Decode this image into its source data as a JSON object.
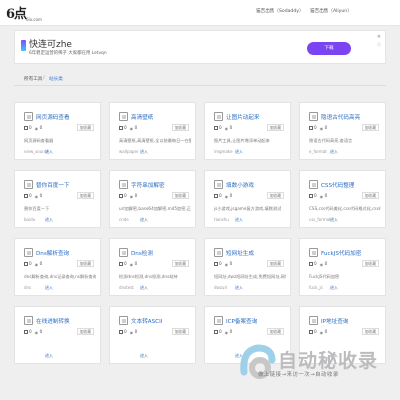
{
  "header": {
    "logo_text": "6点",
    "logo_sub": "6lo.com",
    "links": [
      "猫吉出售（Sodaddy）",
      "猫吉出售（Aliyun）"
    ]
  },
  "ad": {
    "title": "快连可zhe",
    "desc": "6年稳定运营的稀子 大家都在用 Letvqn",
    "button": "下载",
    "close": "✕",
    "info": "ⓘ"
  },
  "breadcrumb": {
    "items": [
      "所有工具",
      "站长类"
    ],
    "separator": "/"
  },
  "fav_label": "加收藏",
  "enter_label": "进入",
  "cards": [
    {
      "title": "网页源码查看",
      "likes": "0",
      "views": "0",
      "desc": "网页源码查看器",
      "slug": "view_source"
    },
    {
      "title": "高清壁纸",
      "likes": "0",
      "views": "0",
      "desc": "高清壁纸,高清壁纸,全以前最每日一在壁纸",
      "slug": "wallpaper"
    },
    {
      "title": "让图片动起来",
      "likes": "0",
      "views": "0",
      "desc": "图片工具,让图片增添单动起来",
      "slug": "imgmake"
    },
    {
      "title": "隐语古代码高亮",
      "likes": "0",
      "views": "0",
      "desc": "隐语古代码高亮,查语言",
      "slug": "e_format"
    },
    {
      "title": "替你百度一下",
      "likes": "0",
      "views": "0",
      "desc": "替你百度一下",
      "slug": "baidu"
    },
    {
      "title": "字符串加解密",
      "likes": "0",
      "views": "0",
      "desc": "url加解密,base64加解密,md5加密,正则...",
      "slug": "cnde"
    },
    {
      "title": "填数小游戏",
      "likes": "0",
      "views": "0",
      "desc": "js小游戏,jsgame复方游戏,填数测试",
      "slug": "tianshu"
    },
    {
      "title": "CSS代码整理",
      "likes": "0",
      "views": "0",
      "desc": "CSS,css代码美化,css代码格式化,css代码...",
      "slug": "css_format"
    },
    {
      "title": "Dns解析查询",
      "likes": "0",
      "views": "0",
      "desc": "dns解析查询,dns记录查询,ns解析查询",
      "slug": "dns"
    },
    {
      "title": "Dns检测",
      "likes": "0",
      "views": "0",
      "desc": "检测dns检测,dns检测,dns劫持",
      "slug": "dnstest"
    },
    {
      "title": "短网址生成",
      "likes": "0",
      "views": "0",
      "desc": "短网址,dwz短网址生成,免费短网址,网址...",
      "slug": "dwzurl"
    },
    {
      "title": "FuckJS代码加密",
      "likes": "0",
      "views": "0",
      "desc": "FuckJS代码加密",
      "slug": "fuck_js"
    },
    {
      "title": "在线进制转换",
      "likes": "0",
      "views": "0",
      "desc": "",
      "slug": ""
    },
    {
      "title": "文本转ASCII",
      "likes": "0",
      "views": "0",
      "desc": "",
      "slug": ""
    },
    {
      "title": "ICP备案查询",
      "likes": "0",
      "views": "0",
      "desc": "",
      "slug": ""
    },
    {
      "title": "IP地址查询",
      "likes": "0",
      "views": "0",
      "desc": "",
      "slug": ""
    }
  ],
  "watermark": {
    "big": "自动秘收录",
    "small": "做上链接→来访一次→自动收录"
  }
}
